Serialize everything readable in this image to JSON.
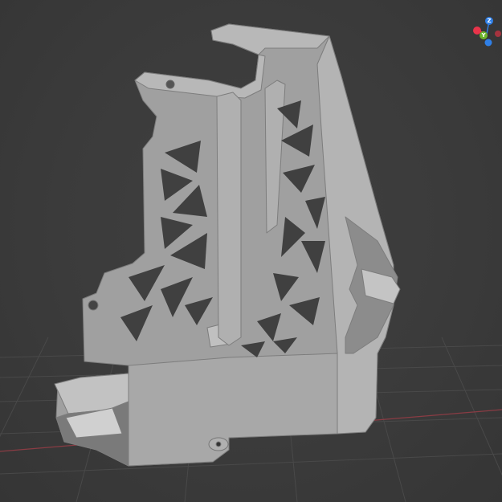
{
  "viewport": {
    "background_color": "#3a3a3a",
    "grid_color": "#4a4a4a",
    "x_axis_line_color": "#8a3c44",
    "model_color": "#9b9b9b"
  },
  "gizmo": {
    "axes": [
      {
        "name": "z",
        "label": "Z",
        "color": "#2f7fe6",
        "icon": "z-axis-dot"
      },
      {
        "name": "x",
        "label": "",
        "color": "#e8344a",
        "icon": "x-axis-dot"
      },
      {
        "name": "y",
        "label": "Y",
        "color": "#6db52c",
        "icon": "y-axis-dot"
      },
      {
        "name": "neg-x",
        "label": "",
        "color": "#e8344a",
        "icon": "neg-x-axis-dot"
      },
      {
        "name": "neg-z",
        "label": "",
        "color": "#2f7fe6",
        "icon": "neg-z-axis-dot"
      }
    ]
  }
}
